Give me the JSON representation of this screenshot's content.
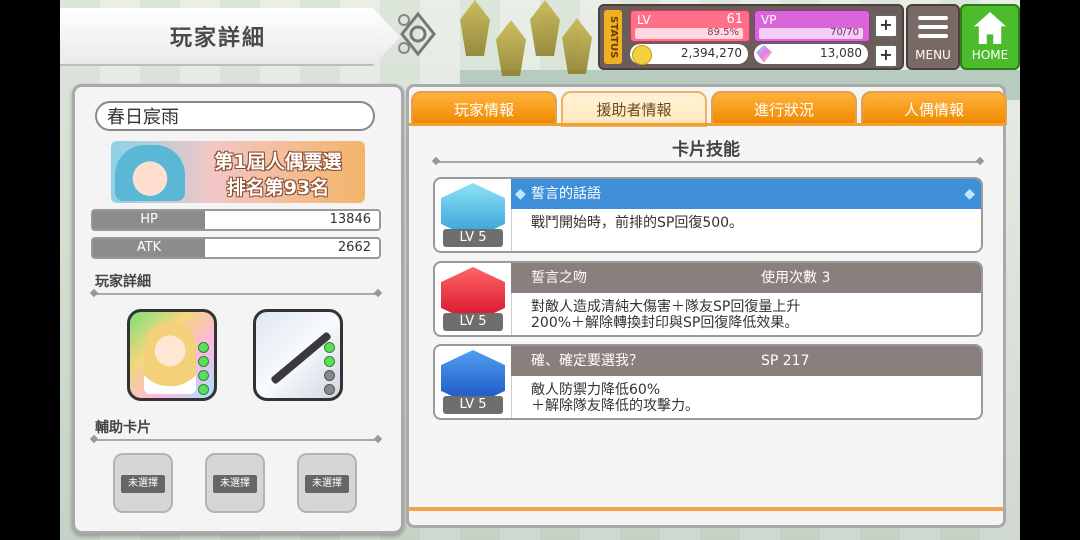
{
  "header": {
    "title": "玩家詳細"
  },
  "status": {
    "label": "STATUS",
    "lv_tag": "LV",
    "lv_value": "61",
    "lv_progress": "89.5%",
    "vp_tag": "VP",
    "vp_value": "70/70",
    "money": "2,394,270",
    "gems": "13,080",
    "plus": "+"
  },
  "nav": {
    "menu": "MENU",
    "home": "HOME"
  },
  "player": {
    "name": "春日宸雨",
    "ranking_line1": "第1屆人偶票選",
    "ranking_line2": "排名第93名",
    "hp_label": "HP",
    "hp_value": "13846",
    "atk_label": "ATK",
    "atk_value": "2662",
    "details_heading": "玩家詳細",
    "support_heading": "輔助卡片",
    "empty_slots": [
      "未選擇",
      "未選擇",
      "未選擇"
    ]
  },
  "tabs": [
    "玩家情報",
    "援助者情報",
    "進行狀況",
    "人偶情報"
  ],
  "active_tab": 1,
  "skills_panel": {
    "title": "卡片技能",
    "skills": [
      {
        "name": "誓言的話語",
        "extra": "",
        "level": "LV 5",
        "desc": [
          "戰鬥開始時，前排的SP回復500。"
        ],
        "icon": "blue-gem-icon"
      },
      {
        "name": "誓言之吻",
        "extra": "使用次數 3",
        "level": "LV 5",
        "desc": [
          "對敵人造成清純大傷害＋隊友SP回復量上升",
          "200%＋解除轉換封印與SP回復降低效果。"
        ],
        "icon": "red-slash-icon"
      },
      {
        "name": "確、確定要選我？",
        "extra": "SP 217",
        "level": "LV 5",
        "desc": [
          "敵人防禦力降低60%",
          "＋解除隊友降低的攻擊力。"
        ],
        "icon": "shield-icon"
      }
    ]
  },
  "colors": {
    "tab_orange": "#f08a00",
    "skill_blue": "#3f8fd8",
    "home_green": "#4cbb2c"
  }
}
